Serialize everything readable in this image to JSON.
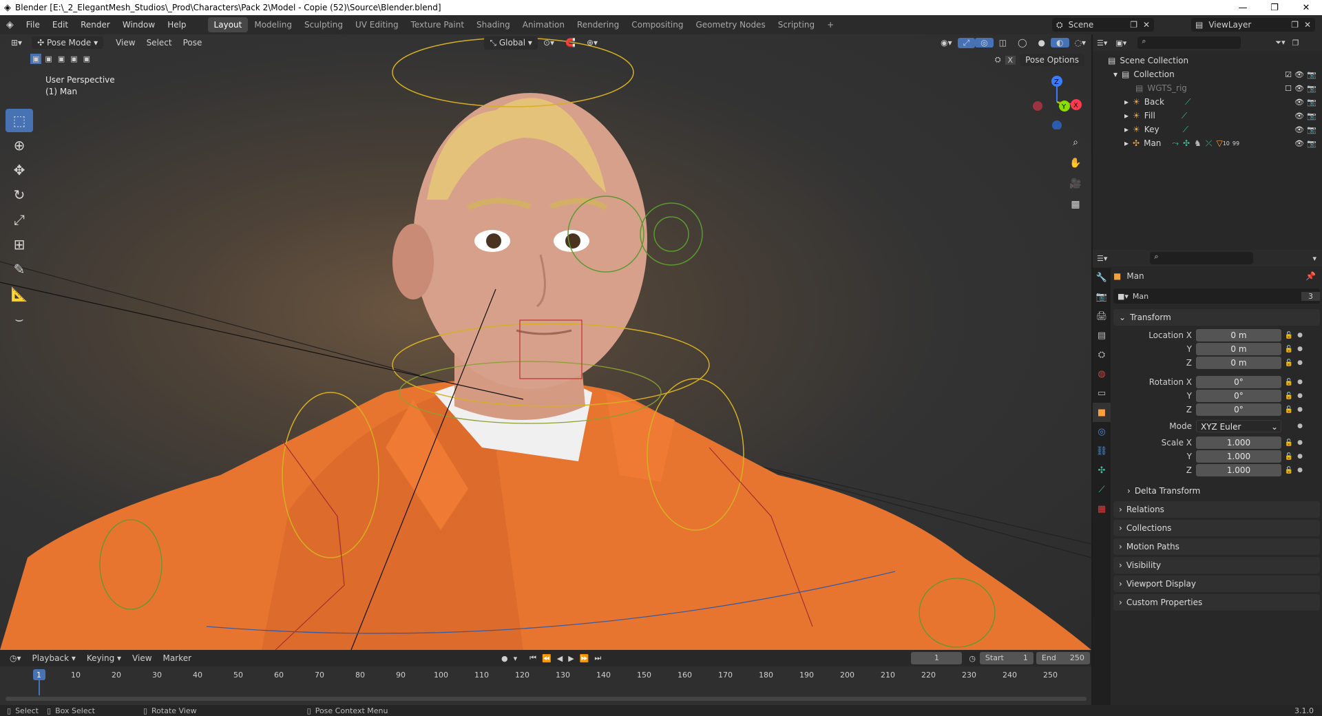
{
  "window": {
    "title": "Blender [E:\\_2_ElegantMesh_Studios\\_Prod\\Characters\\Pack 2\\Model - Copie (52)\\Source\\Blender.blend]"
  },
  "menus": [
    "File",
    "Edit",
    "Render",
    "Window",
    "Help"
  ],
  "workspaces": [
    "Layout",
    "Modeling",
    "Sculpting",
    "UV Editing",
    "Texture Paint",
    "Shading",
    "Animation",
    "Rendering",
    "Compositing",
    "Geometry Nodes",
    "Scripting"
  ],
  "active_workspace": "Layout",
  "scene": {
    "name": "Scene",
    "view_layer": "ViewLayer"
  },
  "viewport": {
    "mode": "Pose Mode",
    "menu": [
      "View",
      "Select",
      "Pose"
    ],
    "orientation": "Global",
    "pose_options": "Pose Options",
    "info_line1": "User Perspective",
    "info_line2": "(1) Man",
    "gizmo_axes": {
      "z": "Z",
      "y": "Y",
      "x": "X"
    }
  },
  "outliner": {
    "root": "Scene Collection",
    "collection": "Collection",
    "items": [
      {
        "name": "WGTS_rig",
        "dim": true
      },
      {
        "name": "Back"
      },
      {
        "name": "Fill"
      },
      {
        "name": "Key"
      },
      {
        "name": "Man",
        "extra": "10",
        "extra2": "99"
      }
    ]
  },
  "properties": {
    "object_name": "Man",
    "data_name": "Man",
    "users": "3",
    "transform_label": "Transform",
    "location_label": "Location X",
    "rotation_label": "Rotation X",
    "scale_label": "Scale X",
    "y_label": "Y",
    "z_label": "Z",
    "location": [
      "0 m",
      "0 m",
      "0 m"
    ],
    "rotation": [
      "0°",
      "0°",
      "0°"
    ],
    "mode_label": "Mode",
    "mode": "XYZ Euler",
    "scale": [
      "1.000",
      "1.000",
      "1.000"
    ],
    "delta_transform": "Delta Transform",
    "panels": [
      "Relations",
      "Collections",
      "Motion Paths",
      "Visibility",
      "Viewport Display",
      "Custom Properties"
    ]
  },
  "timeline": {
    "menu": [
      "Playback",
      "Keying",
      "View",
      "Marker"
    ],
    "current_frame": "1",
    "start_label": "Start",
    "start": "1",
    "end_label": "End",
    "end": "250",
    "ticks": [
      "1",
      "10",
      "20",
      "30",
      "40",
      "50",
      "60",
      "70",
      "80",
      "90",
      "100",
      "110",
      "120",
      "130",
      "140",
      "150",
      "160",
      "170",
      "180",
      "190",
      "200",
      "210",
      "220",
      "230",
      "240",
      "250"
    ]
  },
  "status": {
    "select": "Select",
    "box_select": "Box Select",
    "rotate_view": "Rotate View",
    "context_menu": "Pose Context Menu",
    "version": "3.1.0"
  }
}
